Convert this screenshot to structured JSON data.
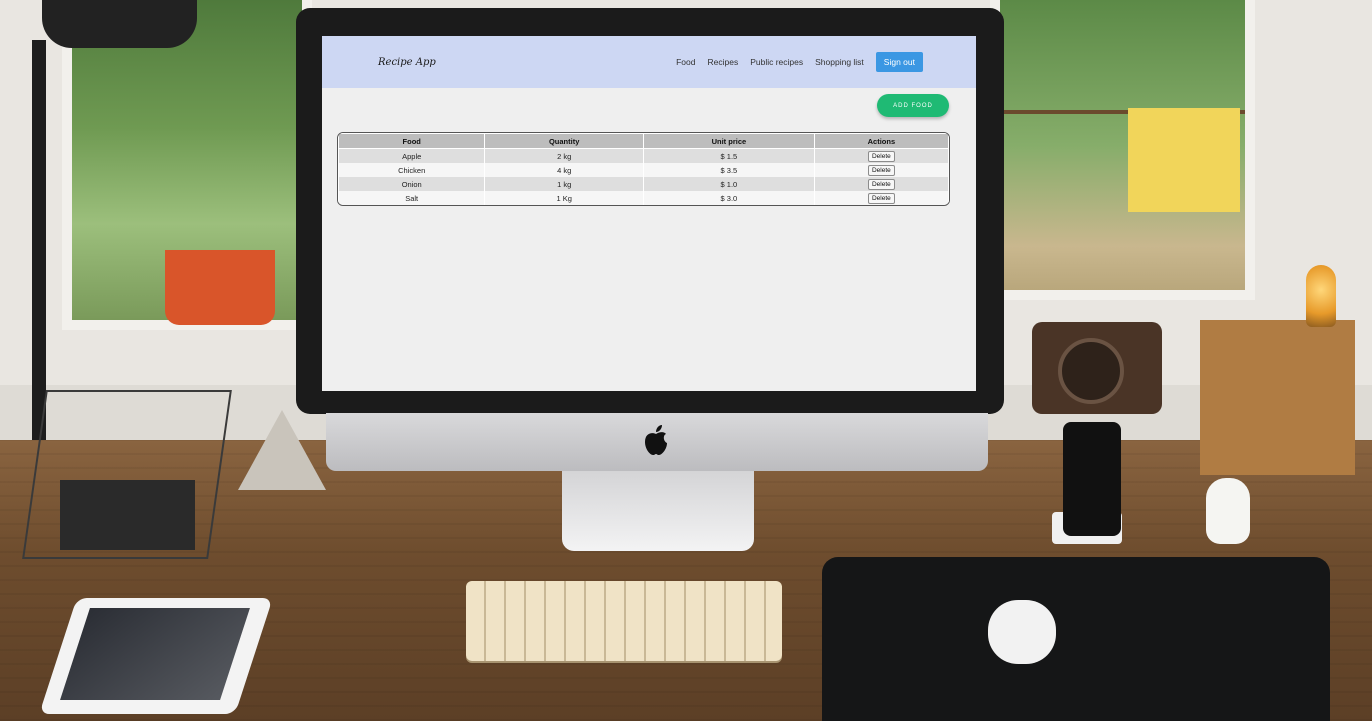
{
  "app": {
    "brand": "Recipe App",
    "nav": {
      "food": "Food",
      "recipes": "Recipes",
      "public_recipes": "Public recipes",
      "shopping_list": "Shopping list",
      "sign_out": "Sign out"
    },
    "add_food_label": "ADD FOOD",
    "table": {
      "headers": [
        "Food",
        "Quantity",
        "Unit price",
        "Actions"
      ],
      "rows": [
        {
          "food": "Apple",
          "quantity": "2 kg",
          "unit_price": "$ 1.5",
          "action": "Delete"
        },
        {
          "food": "Chicken",
          "quantity": "4 kg",
          "unit_price": "$ 3.5",
          "action": "Delete"
        },
        {
          "food": "Onion",
          "quantity": "1 kg",
          "unit_price": "$ 1.0",
          "action": "Delete"
        },
        {
          "food": "Salt",
          "quantity": "1 Kg",
          "unit_price": "$ 3.0",
          "action": "Delete"
        }
      ]
    },
    "colors": {
      "navbar": "#cdd7f3",
      "sign_out_button": "#3b97e3",
      "add_food_button": "#1fba74",
      "table_header": "#bdbdbd"
    }
  }
}
